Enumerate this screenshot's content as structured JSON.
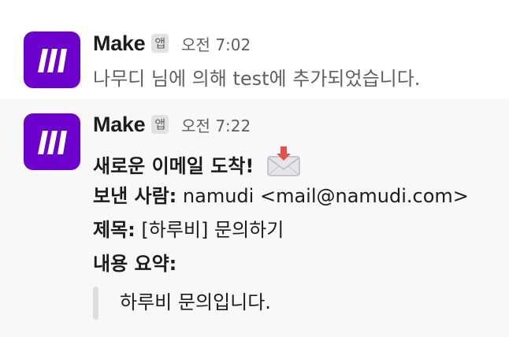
{
  "messages": [
    {
      "sender": "Make",
      "app_badge": "앱",
      "time": "오전 7:02",
      "text": "나무디 님에 의해 test에 추가되었습니다."
    },
    {
      "sender": "Make",
      "app_badge": "앱",
      "time": "오전 7:22",
      "title": "새로운 이메일 도착!",
      "from_label": "보낸 사람:",
      "from_value": "namudi <mail@namudi.com>",
      "subject_label": "제목:",
      "subject_value": "[하루비] 문의하기",
      "summary_label": "내용 요약:",
      "summary_quote": "하루비 문의입니다."
    }
  ],
  "icons": {
    "avatar": "make-logo-icon",
    "title_emoji": "incoming-envelope-icon"
  },
  "colors": {
    "avatar_bg": "#6d00cc",
    "highlight_bg": "#f8f8f8",
    "quote_bar": "#dddddd",
    "muted_text": "#616061"
  }
}
